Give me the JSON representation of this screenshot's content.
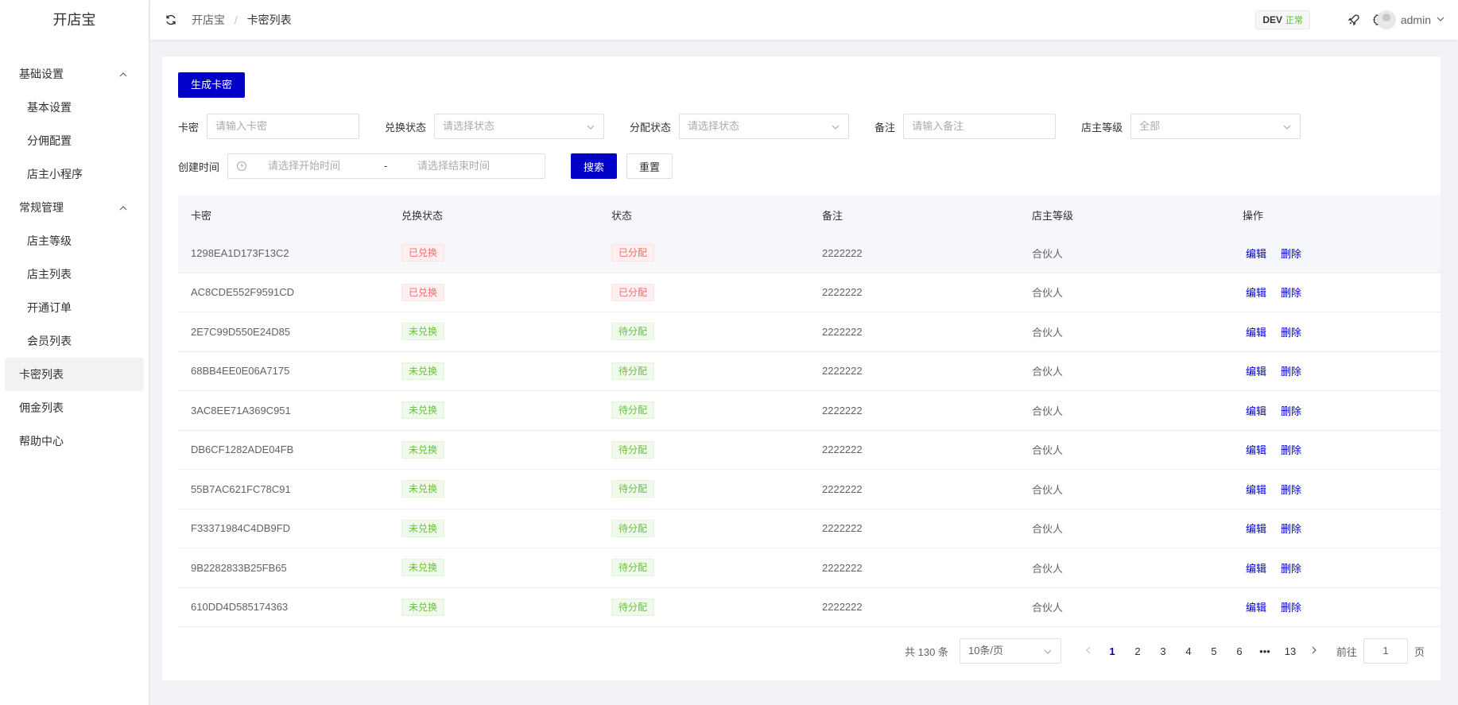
{
  "app": {
    "title": "开店宝"
  },
  "sidebar": {
    "groups": [
      {
        "label": "基础设置",
        "children": [
          "基本设置",
          "分佣配置",
          "店主小程序"
        ]
      },
      {
        "label": "常规管理",
        "children": [
          "店主等级",
          "店主列表",
          "开通订单",
          "会员列表"
        ]
      }
    ],
    "items": [
      "卡密列表",
      "佣金列表",
      "帮助中心"
    ],
    "active": "卡密列表"
  },
  "header": {
    "breadcrumb": [
      "开店宝",
      "卡密列表"
    ],
    "env": {
      "name": "DEV",
      "status": "正常",
      "status_color": "#52c41a"
    },
    "user": "admin"
  },
  "toolbar": {
    "generate_label": "生成卡密"
  },
  "filters": {
    "card": {
      "label": "卡密",
      "placeholder": "请输入卡密"
    },
    "redeem_status": {
      "label": "兑换状态",
      "placeholder": "请选择状态"
    },
    "assign_status": {
      "label": "分配状态",
      "placeholder": "请选择状态"
    },
    "remark": {
      "label": "备注",
      "placeholder": "请输入备注"
    },
    "level": {
      "label": "店主等级",
      "value": "全部"
    },
    "created": {
      "label": "创建时间",
      "start_placeholder": "请选择开始时间",
      "separator": "-",
      "end_placeholder": "请选择结束时间"
    },
    "search_label": "搜索",
    "reset_label": "重置"
  },
  "table": {
    "columns": [
      "卡密",
      "兑换状态",
      "状态",
      "备注",
      "店主等级",
      "操作"
    ],
    "edit_label": "编辑",
    "delete_label": "删除",
    "rows": [
      {
        "code": "1298EA1D173F13C2",
        "redeem": "已兑换",
        "redeem_color": "red",
        "status": "已分配",
        "status_color": "red",
        "remark": "2222222",
        "level": "合伙人"
      },
      {
        "code": "AC8CDE552F9591CD",
        "redeem": "已兑换",
        "redeem_color": "red",
        "status": "已分配",
        "status_color": "red",
        "remark": "2222222",
        "level": "合伙人"
      },
      {
        "code": "2E7C99D550E24D85",
        "redeem": "未兑换",
        "redeem_color": "green",
        "status": "待分配",
        "status_color": "green",
        "remark": "2222222",
        "level": "合伙人"
      },
      {
        "code": "68BB4EE0E06A7175",
        "redeem": "未兑换",
        "redeem_color": "green",
        "status": "待分配",
        "status_color": "green",
        "remark": "2222222",
        "level": "合伙人"
      },
      {
        "code": "3AC8EE71A369C951",
        "redeem": "未兑换",
        "redeem_color": "green",
        "status": "待分配",
        "status_color": "green",
        "remark": "2222222",
        "level": "合伙人"
      },
      {
        "code": "DB6CF1282ADE04FB",
        "redeem": "未兑换",
        "redeem_color": "green",
        "status": "待分配",
        "status_color": "green",
        "remark": "2222222",
        "level": "合伙人"
      },
      {
        "code": "55B7AC621FC78C91",
        "redeem": "未兑换",
        "redeem_color": "green",
        "status": "待分配",
        "status_color": "green",
        "remark": "2222222",
        "level": "合伙人"
      },
      {
        "code": "F33371984C4DB9FD",
        "redeem": "未兑换",
        "redeem_color": "green",
        "status": "待分配",
        "status_color": "green",
        "remark": "2222222",
        "level": "合伙人"
      },
      {
        "code": "9B2282833B25FB65",
        "redeem": "未兑换",
        "redeem_color": "green",
        "status": "待分配",
        "status_color": "green",
        "remark": "2222222",
        "level": "合伙人"
      },
      {
        "code": "610DD4D585174363",
        "redeem": "未兑换",
        "redeem_color": "green",
        "status": "待分配",
        "status_color": "green",
        "remark": "2222222",
        "level": "合伙人"
      }
    ]
  },
  "pagination": {
    "total_text": "共 130 条",
    "page_size": "10条/页",
    "pages": [
      "1",
      "2",
      "3",
      "4",
      "5",
      "6",
      "•••",
      "13"
    ],
    "current": "1",
    "goto_label": "前往",
    "goto_value": "1",
    "page_suffix": "页"
  },
  "colors": {
    "primary": "#0000c8",
    "danger": "#f56c6c",
    "success": "#67c23a"
  }
}
